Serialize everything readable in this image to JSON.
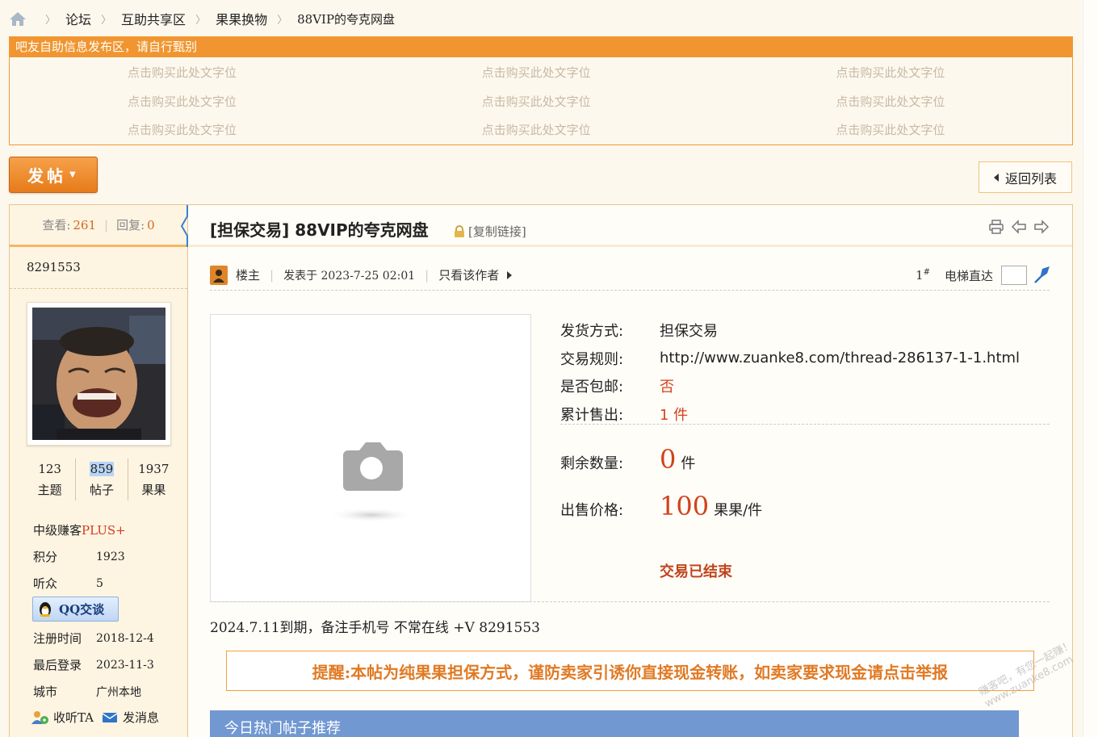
{
  "breadcrumb": {
    "home_icon": "home-icon",
    "items": [
      "论坛",
      "互助共享区",
      "果果换物",
      "88VIP的夸克网盘"
    ]
  },
  "ad": {
    "header": "吧友自助信息发布区，请自行甄别",
    "cells": [
      "点击购买此处文字位",
      "点击购买此处文字位",
      "点击购买此处文字位",
      "点击购买此处文字位",
      "点击购买此处文字位",
      "点击购买此处文字位",
      "点击购买此处文字位",
      "点击购买此处文字位",
      "点击购买此处文字位"
    ]
  },
  "toolbar": {
    "post_label": "发帖",
    "back_label": "返回列表"
  },
  "sidebar": {
    "views_label": "查看:",
    "views": "261",
    "replies_label": "回复:",
    "replies": "0",
    "username": "8291553",
    "counts": [
      {
        "value": "123",
        "label": "主题"
      },
      {
        "value": "859",
        "label": "帖子"
      },
      {
        "value": "1937",
        "label": "果果"
      }
    ],
    "rank": "中级赚客",
    "rank_badge": "PLUS+",
    "points_label": "积分",
    "points": "1923",
    "followers_label": "听众",
    "followers": "5",
    "qq_label": "QQ交谈",
    "reg_label": "注册时间",
    "reg_date": "2018-12-4",
    "last_label": "最后登录",
    "last_date": "2023-11-3",
    "city_label": "城市",
    "city": "广州本地",
    "follow_label": "收听TA",
    "message_label": "发消息"
  },
  "post": {
    "title": "[担保交易] 88VIP的夸克网盘",
    "copy_link": "[复制链接]",
    "author_tag": "楼主",
    "posted_at": "发表于 2023-7-25 02:01",
    "only_author": "只看该作者",
    "floor": "1",
    "floor_sup": "#",
    "elevator": "电梯直达",
    "trade": [
      {
        "label": "发货方式:",
        "value": "担保交易",
        "highlight": false
      },
      {
        "label": "交易规则:",
        "value": "http://www.zuanke8.com/thread-286137-1-1.html",
        "highlight": false
      },
      {
        "label": "是否包邮:",
        "value": "否",
        "highlight": true
      },
      {
        "label": "累计售出:",
        "value": "1 件",
        "highlight": true
      }
    ],
    "remaining_label": "剩余数量:",
    "remaining": "0",
    "remaining_unit": "件",
    "price_label": "出售价格:",
    "price": "100",
    "price_unit": "果果/件",
    "status": "交易已结束",
    "body": "2024.7.11到期，备注手机号  不常在线 +V 8291553",
    "warning": "提醒:本帖为纯果果担保方式，谨防卖家引诱你直接现金转账，如卖家要求现金请点击举报",
    "hot_header": "今日热门帖子推荐"
  },
  "watermark": {
    "line1": "赚客吧，有您一起赚！",
    "line2": "www.zuanke8.com"
  },
  "colors": {
    "accent": "#f0952f",
    "price_red": "#d2421b",
    "hot_blue": "#7298d2"
  }
}
